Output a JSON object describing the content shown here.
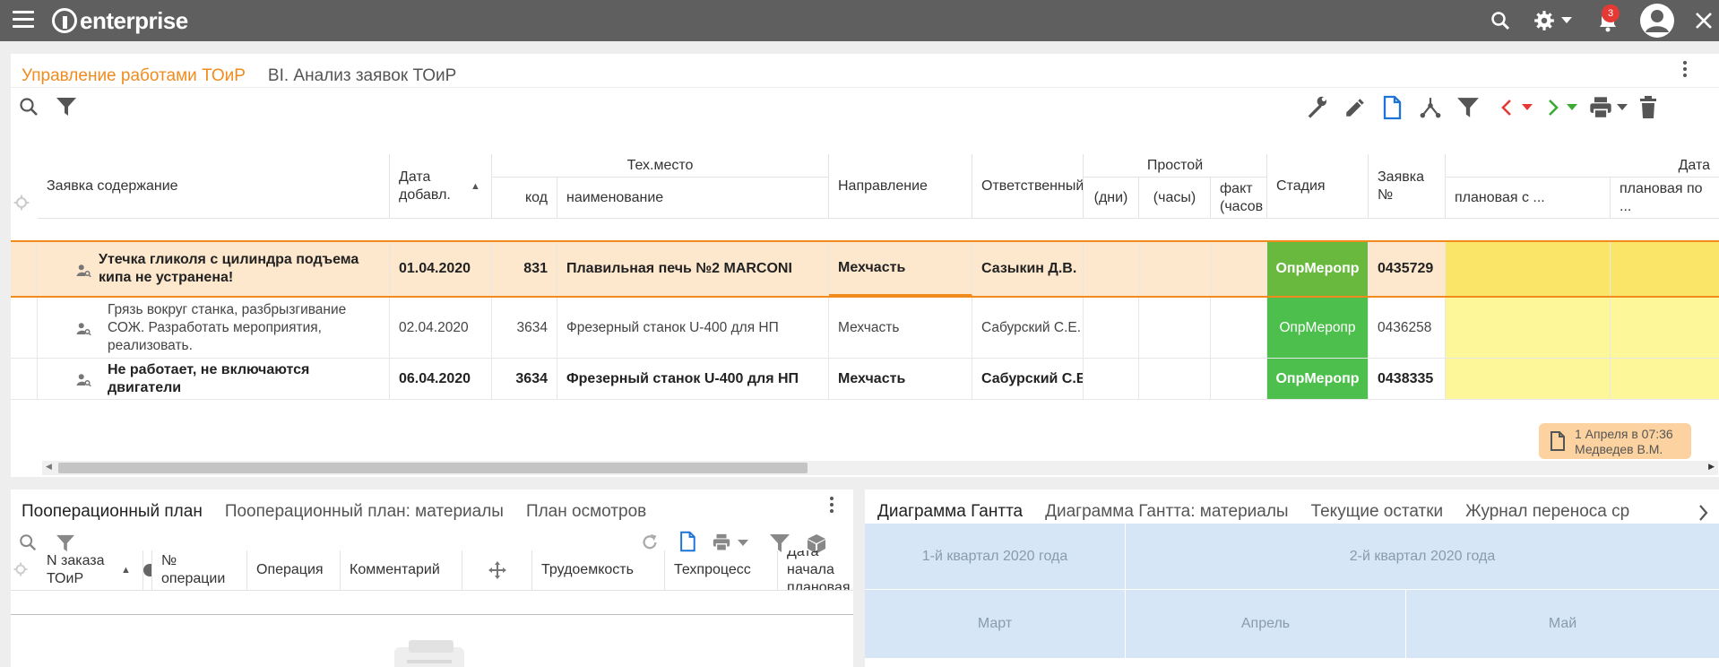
{
  "app": {
    "logo_text": "enterprise",
    "notifications_count": "3"
  },
  "top_panel": {
    "tabs": [
      {
        "label": "Управление работами ТОиР"
      },
      {
        "label": "BI. Анализ заявок ТОиР"
      }
    ],
    "headers": {
      "request_content": "Заявка содержание",
      "date_added": "Дата добавл.",
      "tech_place": "Тех.место",
      "code": "код",
      "name": "наименование",
      "direction": "Направление",
      "responsible": "Ответственный",
      "downtime": "Простой",
      "days": "(дни)",
      "hours": "(часы)",
      "fact_hours": "факт (часов",
      "stage": "Стадия",
      "request_no": "Заявка №",
      "date": "Дата",
      "planned_from": "плановая с ...",
      "planned_to": "плановая по ..."
    },
    "rows": [
      {
        "content": "Утечка гликоля с цилиндра подъема кипа не устранена!",
        "date": "01.04.2020",
        "code": "831",
        "name": "Плавильная печь №2 MARCONI",
        "direction": "Мехчасть",
        "responsible": "Сазыкин Д.В.",
        "stage": "ОпрМеропр",
        "request_no": "0435729",
        "bold": true,
        "selected": true
      },
      {
        "content": "Грязь вокруг станка, разбрызгивание СОЖ. Разработать мероприятия, реализовать.",
        "date": "02.04.2020",
        "code": "3634",
        "name": "Фрезерный станок U-400 для НП",
        "direction": "Мехчасть",
        "responsible": "Сабурский С.Е.",
        "stage": "ОпрМеропр",
        "request_no": "0436258",
        "bold": false,
        "selected": false
      },
      {
        "content": "Не работает,  не включаются двигатели",
        "date": "06.04.2020",
        "code": "3634",
        "name": "Фрезерный станок U-400 для НП",
        "direction": "Мехчасть",
        "responsible": "Сабурский С.Е.",
        "stage": "ОпрМеропр",
        "request_no": "0438335",
        "bold": true,
        "selected": false
      }
    ],
    "note": {
      "date": "1 Апреля в 07:36",
      "user": "Медведев В.М."
    }
  },
  "bottom_left": {
    "tabs": [
      {
        "label": "Пооперационный план"
      },
      {
        "label": "Пооперационный план: материалы"
      },
      {
        "label": "План осмотров"
      }
    ],
    "headers": {
      "order_no": "N заказа ТОиР",
      "op_no": "№ операции",
      "operation": "Операция",
      "comment": "Комментарий",
      "labor": "Трудоемкость",
      "process": "Техпроцесс",
      "start_date": "Дата начала плановая"
    }
  },
  "bottom_right": {
    "tabs": [
      {
        "label": "Диаграмма Гантта"
      },
      {
        "label": "Диаграмма Гантта: материалы"
      },
      {
        "label": "Текущие остатки"
      },
      {
        "label": "Журнал переноса ср"
      }
    ],
    "quarters": [
      "1-й квартал 2020 года",
      "2-й квартал 2020 года"
    ],
    "months": [
      "Март",
      "Апрель",
      "Май"
    ]
  },
  "colors": {
    "accent": "#f28b1e",
    "stage_green": "#4cbf4c",
    "topbar": "#5f5f5f",
    "note": "#fcd3a0",
    "gantt": "#d6e6f7"
  },
  "icons": [
    "menu-icon",
    "search-icon",
    "settings-icon",
    "bell-icon",
    "account-icon",
    "close-icon",
    "filter-icon",
    "wrench-icon",
    "pencil-icon",
    "document-icon",
    "hierarchy-icon",
    "back-icon",
    "forward-icon",
    "print-icon",
    "trash-icon",
    "refresh-icon",
    "cube-icon",
    "move-icon",
    "user-search-icon"
  ]
}
